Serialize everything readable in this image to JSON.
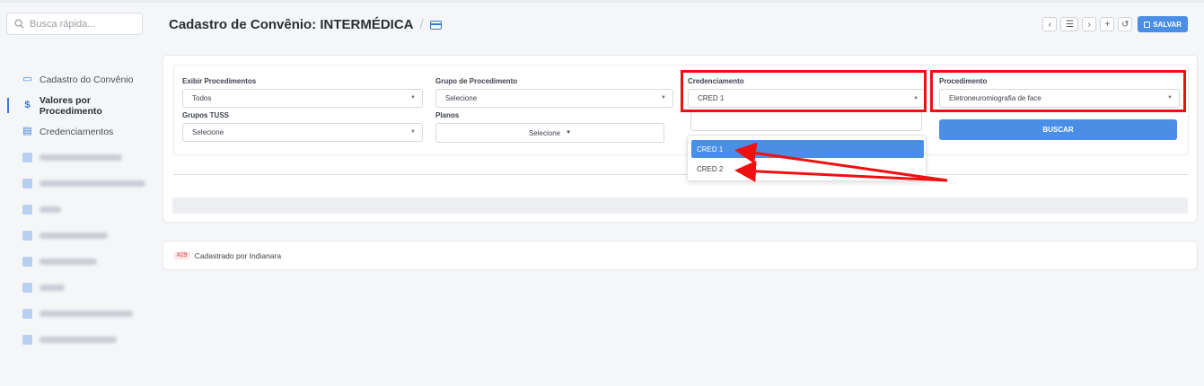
{
  "search": {
    "placeholder": "Busca rápida..."
  },
  "header": {
    "title": "Cadastro de Convênio: INTERMÉDICA",
    "separator": "/",
    "toolbar": {
      "prev": "‹",
      "list": "☰",
      "next": "›",
      "add": "+",
      "history": "↺",
      "save_label": "SALVAR"
    }
  },
  "sidebar": {
    "items": [
      {
        "label": "Cadastro do Convênio",
        "icon": "card-icon",
        "active": false
      },
      {
        "label": "Valores por Procedimento",
        "icon": "dollar-icon",
        "active": true
      },
      {
        "label": "Credenciamentos",
        "icon": "document-icon",
        "active": false
      }
    ],
    "blurred_count": 9
  },
  "form": {
    "exibir_label": "Exibir Procedimentos",
    "exibir_value": "Todos",
    "grupo_label": "Grupo de Procedimento",
    "grupo_value": "Selecione",
    "cred_label": "Credenciamento",
    "cred_value": "CRED 1",
    "proc_label": "Procedimento",
    "proc_value": "Eletroneuromiografia de face",
    "tuss_label": "Grupos TUSS",
    "tuss_value": "Selecione",
    "planos_label": "Planos",
    "planos_value": "Selecione",
    "buscar_label": "BUSCAR"
  },
  "dropdown": {
    "options": [
      "CRED 1",
      "CRED 2"
    ],
    "selected": "CRED 1"
  },
  "footer": {
    "badge": "#29",
    "text": "Cadastrado por Indianara"
  },
  "colors": {
    "accent": "#4a8ee6",
    "highlight": "#ee1111"
  }
}
